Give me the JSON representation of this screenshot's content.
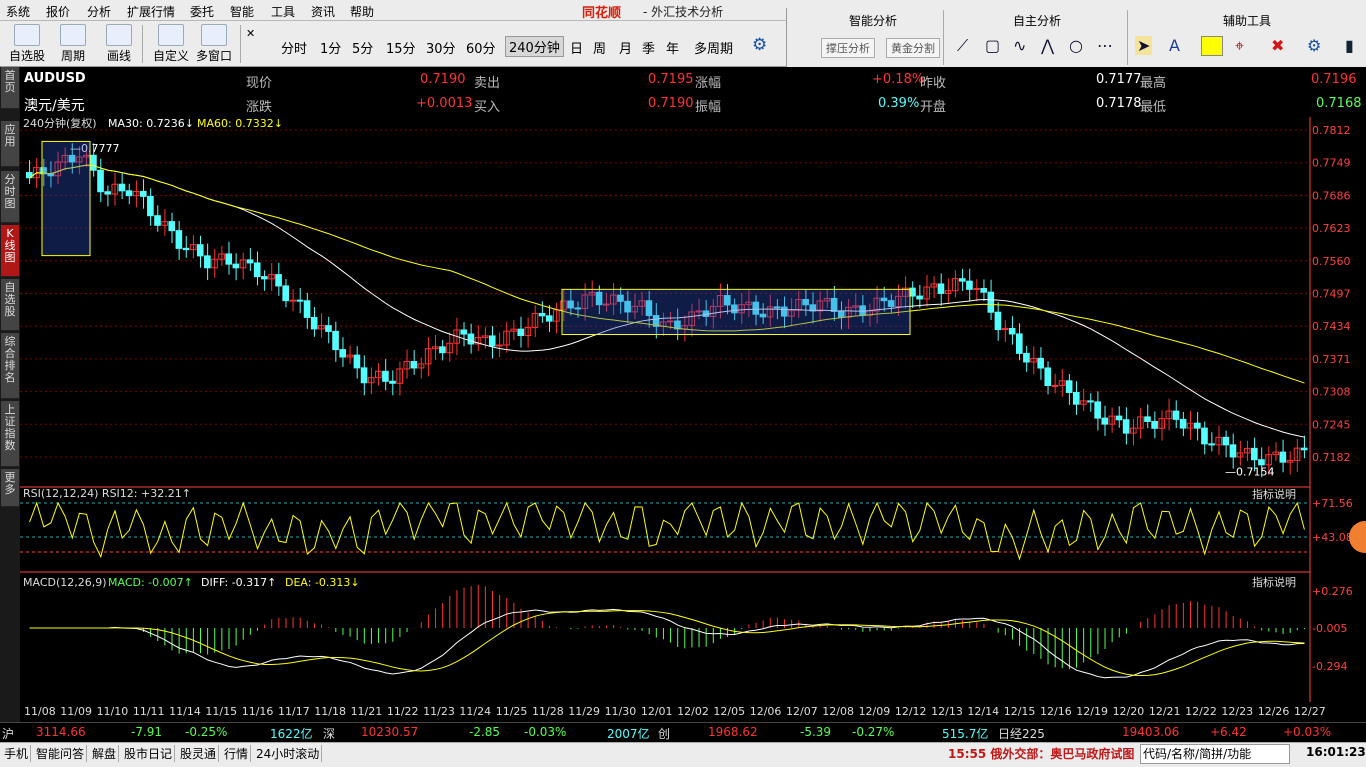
{
  "menu": [
    "系统",
    "报价",
    "分析",
    "扩展行情",
    "委托",
    "智能",
    "工具",
    "资讯",
    "帮助"
  ],
  "brand": "同花顺",
  "brand_sub": " - 外汇技术分析",
  "toolbar": {
    "buttons": [
      {
        "label": "自选股",
        "icon": "star-icon"
      },
      {
        "label": "周期",
        "icon": "clock-icon"
      },
      {
        "label": "画线",
        "icon": "pen-icon"
      },
      {
        "label": "自定义",
        "icon": "layout-icon"
      },
      {
        "label": "多窗口",
        "icon": "multiwindow-icon"
      }
    ],
    "periods": [
      "分时",
      "1分",
      "5分",
      "15分",
      "30分",
      "60分",
      "240分钟",
      "日",
      "周",
      "月",
      "季",
      "年",
      "多周期"
    ],
    "active_period": "240分钟"
  },
  "right_panel": {
    "smart": "智能分析",
    "smart_buttons": [
      "撑压分析",
      "黄金分割"
    ],
    "self": "自主分析",
    "aux": "辅助工具"
  },
  "left_tabs": [
    "首页",
    "应用",
    "分时图",
    "K线图",
    "自选股",
    "综合排名",
    "上证指数",
    "更多"
  ],
  "quote": {
    "symbol": "AUDUSD",
    "name": "澳元/美元",
    "row1": [
      [
        "现价",
        "0.7190",
        "卖出",
        "0.7195",
        "涨幅",
        "+0.18%",
        "昨收",
        "0.7177",
        "最高",
        "0.7196"
      ]
    ],
    "row2": [
      [
        "涨跌",
        "+0.0013",
        "买入",
        "0.7190",
        "振幅",
        "0.39%",
        "开盘",
        "0.7178",
        "最低",
        "0.7168"
      ]
    ]
  },
  "indicators": {
    "k_title": "240分钟(复权)",
    "ma30": "MA30: 0.7236",
    "ma60": "MA60: 0.7332",
    "rsi": "RSI(12,12,24)  RSI12: +32.21",
    "macd_title": "MACD(12,26,9)",
    "macd": "MACD: -0.007",
    "diff": "DIFF: -0.317",
    "dea": "DEA: -0.313",
    "explain": "指标说明"
  },
  "colors": {
    "up": "#ff3232",
    "down": "#54ffff",
    "ma": "#ffff00",
    "grid": "#800000",
    "axis": "#ff4040"
  },
  "chart_data": {
    "type": "candlestick",
    "price_ticks": [
      "0.7812",
      "0.7749",
      "0.7686",
      "0.7623",
      "0.7560",
      "0.7497",
      "0.7434",
      "0.7371",
      "0.7308",
      "0.7245",
      "0.7182"
    ],
    "high_label": "0.7777",
    "low_label": "0.7154",
    "rsi_ticks": [
      "+71.56",
      "+43.08"
    ],
    "macd_ticks": [
      "+0.276",
      "-0.005",
      "-0.294"
    ],
    "dates": [
      "11/08",
      "11/09",
      "11/10",
      "11/11",
      "11/14",
      "11/15",
      "11/16",
      "11/17",
      "11/18",
      "11/21",
      "11/22",
      "11/23",
      "11/24",
      "11/25",
      "11/28",
      "11/29",
      "11/30",
      "12/01",
      "12/02",
      "12/05",
      "12/06",
      "12/07",
      "12/08",
      "12/09",
      "12/12",
      "12/13",
      "12/14",
      "12/15",
      "12/16",
      "12/19",
      "12/20",
      "12/21",
      "12/22",
      "12/23",
      "12/26",
      "12/27"
    ],
    "close_path": [
      0.772,
      0.774,
      0.777,
      0.769,
      0.77,
      0.764,
      0.759,
      0.756,
      0.756,
      0.754,
      0.75,
      0.745,
      0.74,
      0.734,
      0.733,
      0.736,
      0.739,
      0.742,
      0.74,
      0.742,
      0.745,
      0.747,
      0.749,
      0.748,
      0.747,
      0.743,
      0.745,
      0.748,
      0.747,
      0.746,
      0.747,
      0.748,
      0.746,
      0.747,
      0.749,
      0.75,
      0.751,
      0.752,
      0.744,
      0.738,
      0.733,
      0.73,
      0.726,
      0.724,
      0.725,
      0.726,
      0.722,
      0.72,
      0.718,
      0.718,
      0.719
    ]
  },
  "status": {
    "sh": "沪",
    "sh_val": "3114.66",
    "sh_chg": "-7.91",
    "sh_pct": "-0.25%",
    "sh_amt": "1622亿",
    "sz": "深",
    "sz_val": "10230.57",
    "sz_chg": "-2.85",
    "sz_pct": "-0.03%",
    "cy_amt": "2007亿",
    "cy": "创",
    "cy_val": "1968.62",
    "cy_chg": "-5.39",
    "cy_pct": "-0.27%",
    "nk_amt": "515.7亿",
    "nk": "日经225",
    "nk_val": "19403.06",
    "nk_chg": "+6.42",
    "nk_pct": "+0.03%"
  },
  "taskbar": {
    "items": [
      "手机",
      "智能问答",
      "解盘",
      "股市日记",
      "股灵通",
      "行情",
      "24小时滚动"
    ],
    "news": "15:55 俄外交部：奥巴马政府试图",
    "search": "代码/名称/简拼/功能",
    "time": "16:01:23"
  }
}
